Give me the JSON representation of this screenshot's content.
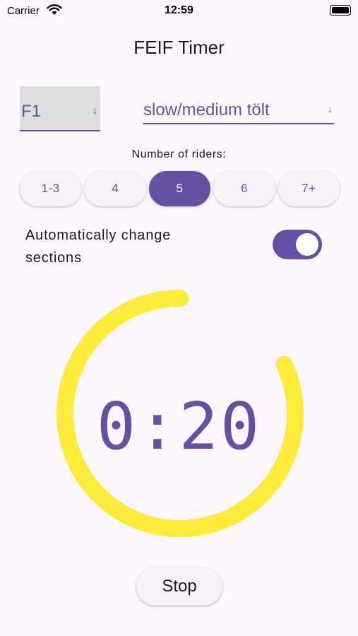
{
  "status_bar": {
    "carrier": "Carrier",
    "time": "12:59"
  },
  "app": {
    "title": "FEIF Timer"
  },
  "test_select": {
    "value": "F1",
    "arrow": "↓"
  },
  "gait_select": {
    "value": "slow/medium tölt",
    "arrow": "↓"
  },
  "riders": {
    "label": "Number of riders:",
    "options": [
      "1-3",
      "4",
      "5",
      "6",
      "7+"
    ],
    "selected": "5"
  },
  "auto_change": {
    "label": "Automatically change sections",
    "enabled": true
  },
  "timer": {
    "display": "0:20",
    "progress_fraction": 0.82,
    "ring_color": "#ffeb3b"
  },
  "stop_button": {
    "label": "Stop"
  },
  "colors": {
    "accent": "#6750a4",
    "background": "#fdf8fd"
  }
}
